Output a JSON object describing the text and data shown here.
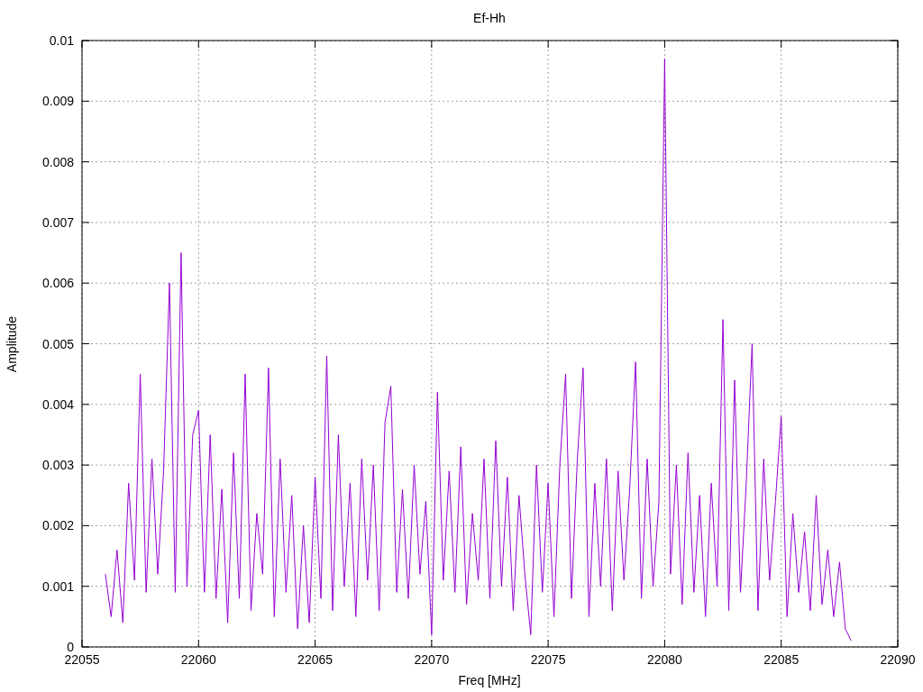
{
  "chart_data": {
    "type": "line",
    "title": "Ef-Hh",
    "xlabel": "Freq [MHz]",
    "ylabel": "Amplitude",
    "xlim": [
      22055,
      22090
    ],
    "ylim": [
      0,
      0.01
    ],
    "xticks": [
      22055,
      22060,
      22065,
      22070,
      22075,
      22080,
      22085,
      22090
    ],
    "yticks": [
      0,
      0.001,
      0.002,
      0.003,
      0.004,
      0.005,
      0.006,
      0.007,
      0.008,
      0.009,
      0.01
    ],
    "x": [
      22056,
      22056.25,
      22056.5,
      22056.75,
      22057,
      22057.25,
      22057.5,
      22057.75,
      22058,
      22058.25,
      22058.5,
      22058.75,
      22059,
      22059.25,
      22059.5,
      22059.75,
      22060,
      22060.25,
      22060.5,
      22060.75,
      22061,
      22061.25,
      22061.5,
      22061.75,
      22062,
      22062.25,
      22062.5,
      22062.75,
      22063,
      22063.25,
      22063.5,
      22063.75,
      22064,
      22064.25,
      22064.5,
      22064.75,
      22065,
      22065.25,
      22065.5,
      22065.75,
      22066,
      22066.25,
      22066.5,
      22066.75,
      22067,
      22067.25,
      22067.5,
      22067.75,
      22068,
      22068.25,
      22068.5,
      22068.75,
      22069,
      22069.25,
      22069.5,
      22069.75,
      22070,
      22070.25,
      22070.5,
      22070.75,
      22071,
      22071.25,
      22071.5,
      22071.75,
      22072,
      22072.25,
      22072.5,
      22072.75,
      22073,
      22073.25,
      22073.5,
      22073.75,
      22074,
      22074.25,
      22074.5,
      22074.75,
      22075,
      22075.25,
      22075.5,
      22075.75,
      22076,
      22076.25,
      22076.5,
      22076.75,
      22077,
      22077.25,
      22077.5,
      22077.75,
      22078,
      22078.25,
      22078.5,
      22078.75,
      22079,
      22079.25,
      22079.5,
      22079.75,
      22080,
      22080.25,
      22080.5,
      22080.75,
      22081,
      22081.25,
      22081.5,
      22081.75,
      22082,
      22082.25,
      22082.5,
      22082.75,
      22083,
      22083.25,
      22083.5,
      22083.75,
      22084,
      22084.25,
      22084.5,
      22084.75,
      22085,
      22085.25,
      22085.5,
      22085.75,
      22086,
      22086.25,
      22086.5,
      22086.75,
      22087,
      22087.25,
      22087.5,
      22087.75,
      22088
    ],
    "grid": true,
    "series": [
      {
        "color": "#9400d3",
        "values": [
          0.0012,
          0.0005,
          0.0016,
          0.0004,
          0.0027,
          0.0011,
          0.0045,
          0.0009,
          0.0031,
          0.0012,
          0.0029,
          0.006,
          0.0009,
          0.0065,
          0.001,
          0.0035,
          0.0039,
          0.0009,
          0.0035,
          0.0008,
          0.0026,
          0.0004,
          0.0032,
          0.0008,
          0.0045,
          0.0006,
          0.0022,
          0.0012,
          0.0046,
          0.0005,
          0.0031,
          0.0009,
          0.0025,
          0.0003,
          0.002,
          0.0004,
          0.0028,
          0.0008,
          0.0048,
          0.0006,
          0.0035,
          0.001,
          0.0027,
          0.0005,
          0.0031,
          0.0011,
          0.003,
          0.0006,
          0.0037,
          0.0043,
          0.0009,
          0.0026,
          0.0008,
          0.003,
          0.0012,
          0.0024,
          0.0002,
          0.0042,
          0.0011,
          0.0029,
          0.0009,
          0.0033,
          0.0007,
          0.0022,
          0.0011,
          0.0031,
          0.0008,
          0.0034,
          0.001,
          0.0028,
          0.0006,
          0.0025,
          0.0012,
          0.0002,
          0.003,
          0.0009,
          0.0027,
          0.0005,
          0.003,
          0.0045,
          0.0008,
          0.0031,
          0.0046,
          0.0005,
          0.0027,
          0.001,
          0.0031,
          0.0006,
          0.0029,
          0.0011,
          0.0026,
          0.0047,
          0.0008,
          0.0031,
          0.001,
          0.0024,
          0.0097,
          0.0012,
          0.003,
          0.0007,
          0.0032,
          0.0009,
          0.0025,
          0.0005,
          0.0027,
          0.001,
          0.0054,
          0.0006,
          0.0044,
          0.0009,
          0.0027,
          0.005,
          0.0006,
          0.0031,
          0.0011,
          0.0024,
          0.0038,
          0.0005,
          0.0022,
          0.0009,
          0.0019,
          0.0006,
          0.0025,
          0.0007,
          0.0016,
          0.0005,
          0.0014,
          0.0003,
          0.0001
        ]
      }
    ]
  }
}
